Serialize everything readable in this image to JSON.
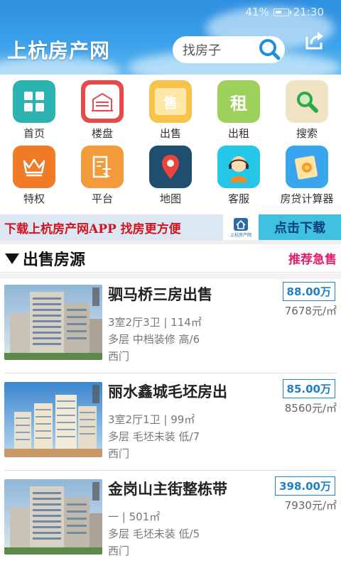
{
  "status": {
    "battery": "41%",
    "time": "21:30"
  },
  "header": {
    "title": "上杭房产网",
    "search_placeholder": "找房子"
  },
  "nav": [
    {
      "label": "首页",
      "icon": "grid-icon",
      "color": "#2bb3b1"
    },
    {
      "label": "楼盘",
      "icon": "building-icon",
      "color": "#e84a4a"
    },
    {
      "label": "出售",
      "icon": "for-sale-folder-icon",
      "color": "#f7c34d",
      "glyph": "售"
    },
    {
      "label": "出租",
      "icon": "for-rent-icon",
      "color": "#9dd15b",
      "glyph": "租"
    },
    {
      "label": "搜索",
      "icon": "search-icon",
      "color": "#eee3c2"
    },
    {
      "label": "特权",
      "icon": "crown-icon",
      "color": "#f07a26"
    },
    {
      "label": "平台",
      "icon": "document-icon",
      "color": "#f39a3a"
    },
    {
      "label": "地图",
      "icon": "map-pin-icon",
      "color": "#1f4f6e"
    },
    {
      "label": "客服",
      "icon": "customer-service-icon",
      "color": "#25c7e8"
    },
    {
      "label": "房贷计算器",
      "icon": "calculator-icon",
      "color": "#3aa5ef"
    }
  ],
  "banner": {
    "text": "下载上杭房产网APP  找房更方便",
    "logo_caption": "上杭房产网",
    "cta": "点击下载"
  },
  "section": {
    "title": "出售房源",
    "link": "推荐急售"
  },
  "listings": [
    {
      "title": "驷马桥三房出售",
      "layout": "3室2厅3卫 | 114㎡",
      "details": "多层 中档装修 高/6",
      "area": "西门",
      "price": "88.00万",
      "unit_price": "7678元/㎡"
    },
    {
      "title": "丽水鑫城毛坯房出",
      "layout": "3室2厅1卫 | 99㎡",
      "details": "多层 毛坯未装 低/7",
      "area": "西门",
      "price": "85.00万",
      "unit_price": "8560元/㎡"
    },
    {
      "title": "金岗山主街整栋带",
      "layout": "一 | 501㎡",
      "details": "多层 毛坯未装 低/5",
      "area": "西门",
      "price": "398.00万",
      "unit_price": "7930元/㎡"
    }
  ]
}
